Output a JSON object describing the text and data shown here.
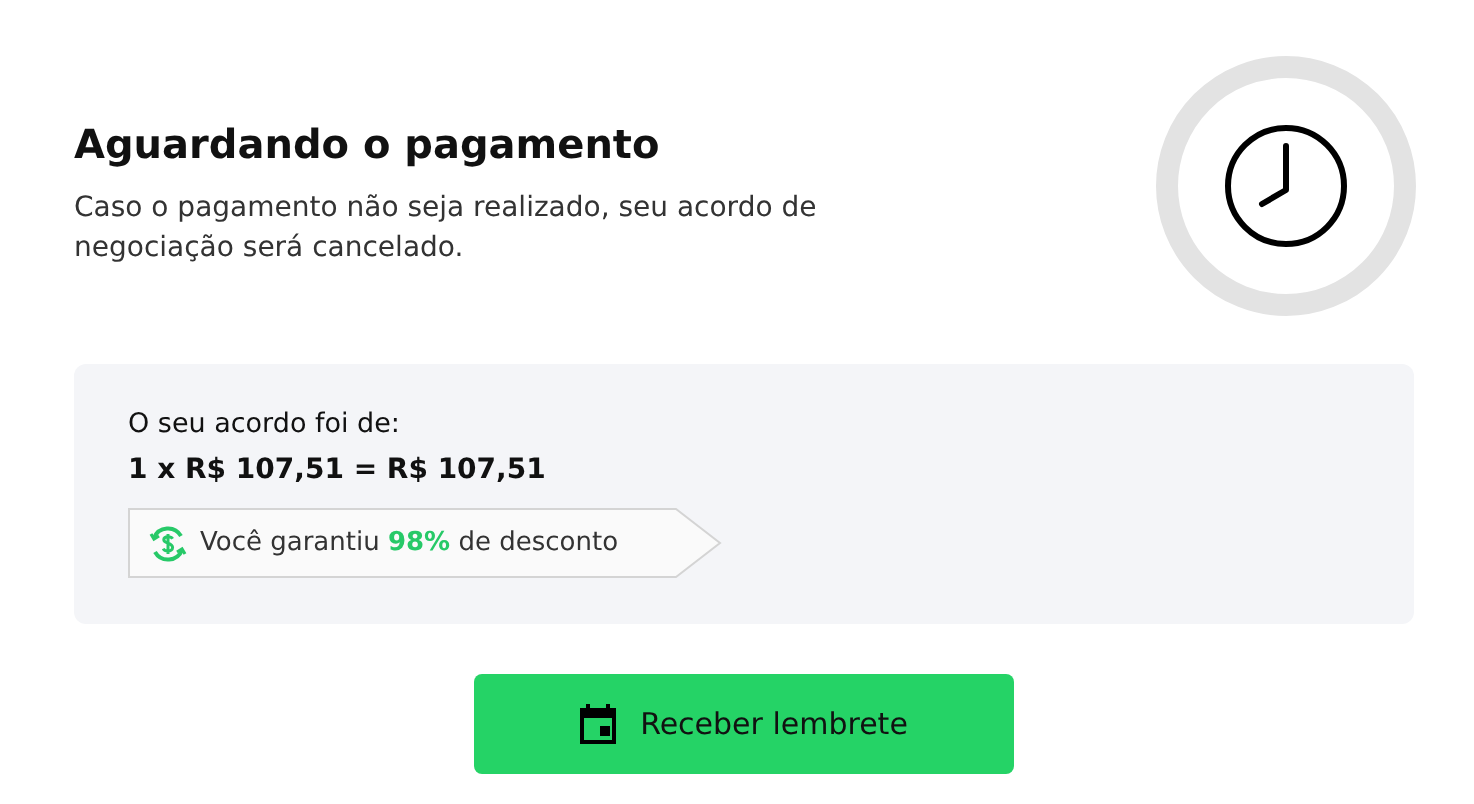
{
  "title": "Aguardando o pagamento",
  "message": "Caso o pagamento não seja realizado, seu acordo de negociação será cancelado.",
  "agreement": {
    "label": "O seu acordo foi de:",
    "amount": "1 x R$ 107,51 = R$ 107,51",
    "discount": {
      "before": "Você garantiu",
      "highlight": "98%",
      "after": "de desconto"
    }
  },
  "button": {
    "label": "Receber lembrete"
  }
}
